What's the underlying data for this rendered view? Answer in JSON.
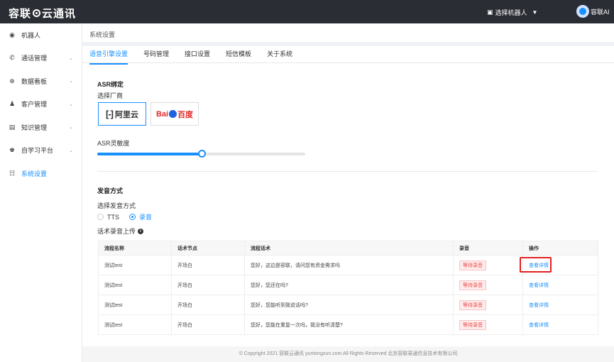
{
  "header": {
    "logo_text_a": "容联",
    "logo_text_b": "云通讯",
    "robot_select": "选择机器人",
    "user_name": "容联AI"
  },
  "sidebar": {
    "items": [
      {
        "label": "机器人",
        "icon": "robot-icon",
        "has_chevron": false
      },
      {
        "label": "通话管理",
        "icon": "phone-icon",
        "has_chevron": true
      },
      {
        "label": "数据看板",
        "icon": "chart-icon",
        "has_chevron": true
      },
      {
        "label": "客户管理",
        "icon": "users-icon",
        "has_chevron": true
      },
      {
        "label": "知识管理",
        "icon": "book-icon",
        "has_chevron": true
      },
      {
        "label": "自学习平台",
        "icon": "learn-icon",
        "has_chevron": true
      },
      {
        "label": "系统设置",
        "icon": "settings-icon",
        "has_chevron": false,
        "active": true
      }
    ]
  },
  "breadcrumb": "系统设置",
  "tabs": [
    "语音引擎设置",
    "号码管理",
    "接口设置",
    "短信模板",
    "关于系统"
  ],
  "asr": {
    "title": "ASR绑定",
    "vendor_label": "选择厂商",
    "vendors": {
      "aliyun_mark": "[-]",
      "aliyun": "阿里云",
      "baidu_a": "Bai",
      "baidu_b": "百度"
    },
    "sensitivity_label": "ASR灵敏度",
    "sensitivity_value": 0.5
  },
  "voice": {
    "title": "发音方式",
    "mode_label": "选择发音方式",
    "options": [
      "TTS",
      "录音"
    ],
    "selected": "录音",
    "upload_label": "话术录音上传"
  },
  "table": {
    "headers": [
      "流程名称",
      "话术节点",
      "流程话术",
      "录音",
      "操作"
    ],
    "rows": [
      [
        "测试test",
        "开场白",
        "您好，这边是容联，请问您有资金需求吗",
        "等待录音",
        "查看详情"
      ],
      [
        "测试test",
        "开场白",
        "您好，您还在吗?",
        "等待录音",
        "查看详情"
      ],
      [
        "测试test",
        "开场白",
        "您好，您能听到我说话吗?",
        "等待录音",
        "查看详情"
      ],
      [
        "测试test",
        "开场白",
        "您好，您能在重复一次吗，我没有听清楚?",
        "等待录音",
        "查看详情"
      ]
    ]
  },
  "footer": "© Copyright 2021   容联云通讯   yuntongxun.com   All Rights Reserved  北京容联易通信息技术有限公司",
  "colors": {
    "accent": "#1890ff",
    "topbar": "#2a2d33",
    "badge": "#f04b4b",
    "highlight": "#e02020"
  }
}
